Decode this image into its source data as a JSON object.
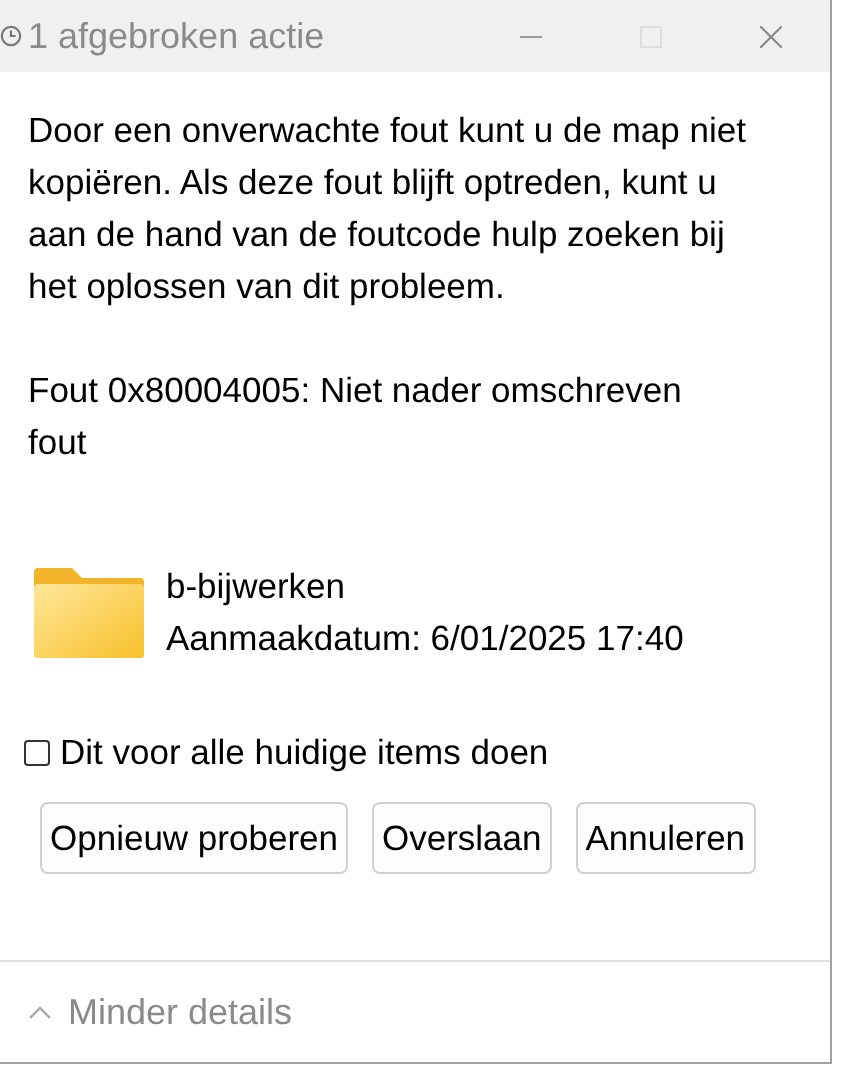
{
  "window": {
    "title": "1 afgebroken actie"
  },
  "message": "Door een onverwachte fout kunt u de map niet kopiëren. Als deze fout blijft optreden, kunt u aan de hand van de foutcode hulp zoeken bij het oplossen van dit probleem.",
  "error": "Fout 0x80004005: Niet nader omschreven fout",
  "item": {
    "name": "b-bijwerken",
    "created": "Aanmaakdatum: 6/01/2025 17:40"
  },
  "apply_all": {
    "label": "Dit voor alle huidige items doen",
    "checked": false
  },
  "buttons": [
    "Opnieuw proberen",
    "Overslaan",
    "Annuleren"
  ],
  "details_toggle": {
    "label": "Minder details",
    "expanded": true
  }
}
